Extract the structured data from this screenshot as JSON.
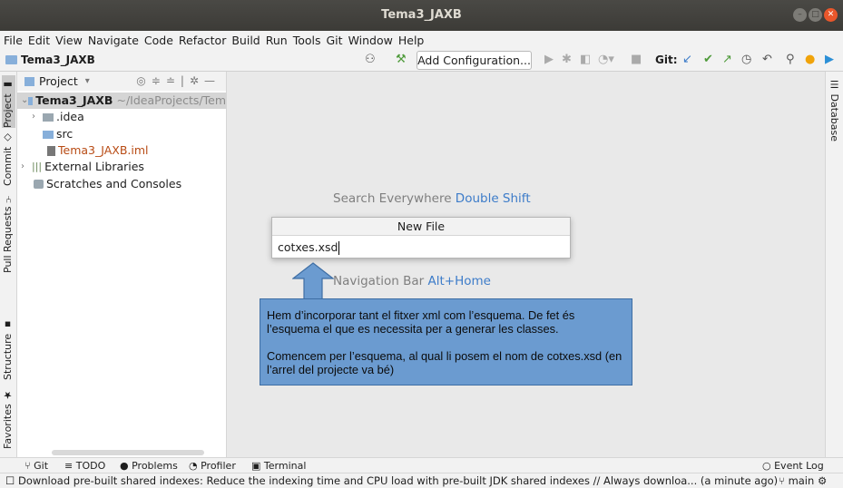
{
  "window": {
    "title": "Tema3_JAXB"
  },
  "menu": [
    "File",
    "Edit",
    "View",
    "Navigate",
    "Code",
    "Refactor",
    "Build",
    "Run",
    "Tools",
    "Git",
    "Window",
    "Help"
  ],
  "navbar": {
    "project": "Tema3_JAXB",
    "add_configuration": "Add Configuration...",
    "git_label": "Git:"
  },
  "left_tabs": [
    "Project",
    "Commit",
    "Pull Requests",
    "Structure",
    "Favorites"
  ],
  "right_tabs": [
    "Database"
  ],
  "project_panel": {
    "view_selector": "Project",
    "tree": [
      {
        "name": "Tema3_JAXB",
        "path": "~/IdeaProjects/Tem"
      },
      {
        "name": ".idea"
      },
      {
        "name": "src"
      },
      {
        "name": "Tema3_JAXB.iml"
      },
      {
        "name": "External Libraries"
      },
      {
        "name": "Scratches and Consoles"
      }
    ]
  },
  "editor": {
    "search_hint": "Search Everywhere",
    "search_key": "Double Shift",
    "nav_hint": "Navigation Bar",
    "nav_key": "Alt+Home"
  },
  "new_file_dialog": {
    "title": "New File",
    "value": "cotxes.xsd"
  },
  "callout": {
    "p1": "Hem d’incorporar tant el fitxer xml com l’esquema. De fet és l’esquema el que es necessita per a generar les classes.",
    "p2": "Comencem per l’esquema, al qual li posem el nom de cotxes.xsd (en l’arrel del projecte va bé)"
  },
  "bottom_tabs": [
    "Git",
    "TODO",
    "Problems",
    "Profiler",
    "Terminal",
    "Event Log"
  ],
  "status": {
    "message": "Download pre-built shared indexes: Reduce the indexing time and CPU load with pre-built JDK shared indexes // Always downloa... (a minute ago)",
    "branch": "main"
  },
  "colors": {
    "callout_bg": "#6b9bd0",
    "key_blue": "#3d7cc9",
    "excluded_file": "#b84b14"
  }
}
